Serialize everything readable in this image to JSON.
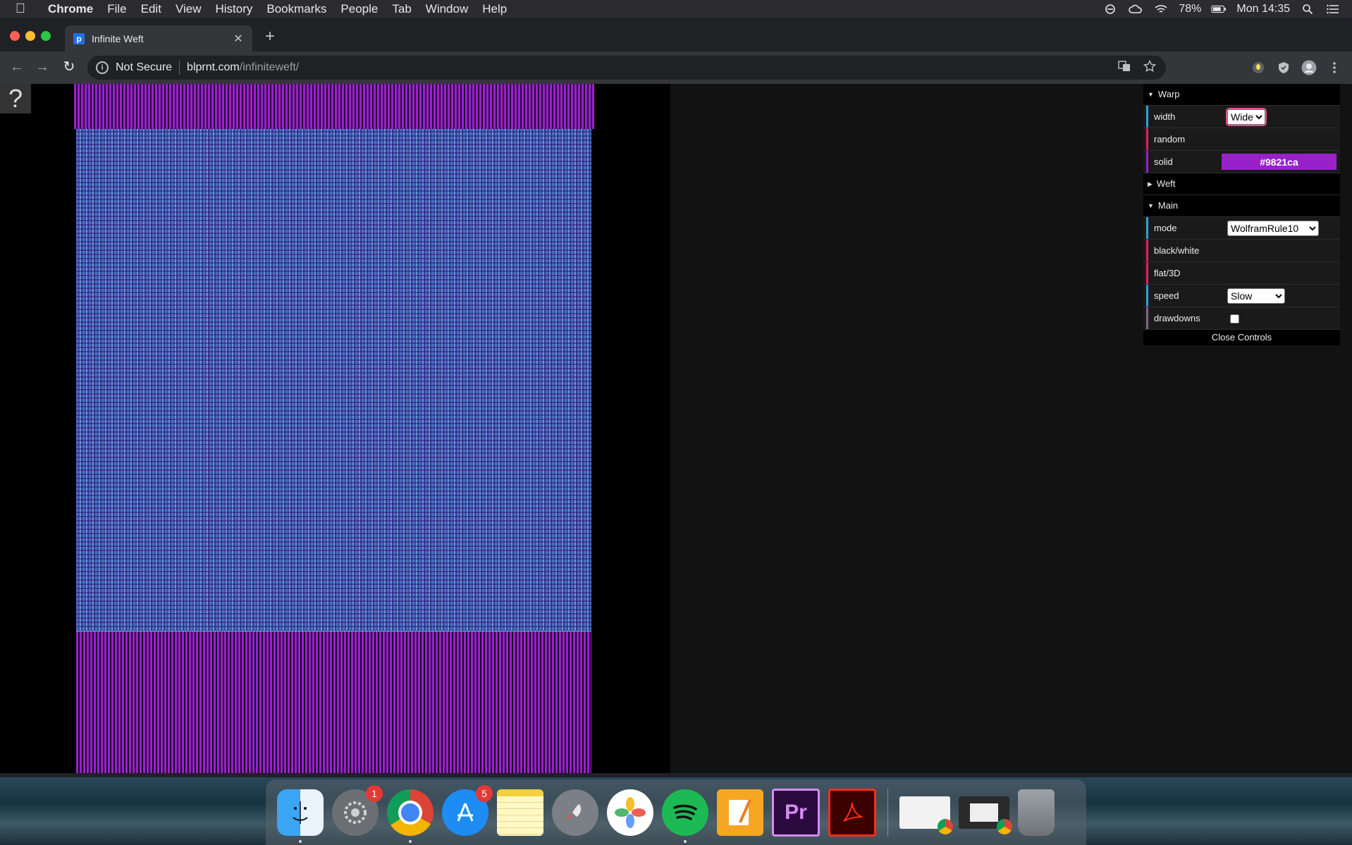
{
  "menubar": {
    "app_name": "Chrome",
    "items": [
      "File",
      "Edit",
      "View",
      "History",
      "Bookmarks",
      "People",
      "Tab",
      "Window",
      "Help"
    ],
    "battery": "78%",
    "clock": "Mon 14:35"
  },
  "browser": {
    "tab_title": "Infinite Weft",
    "tab_favicon": "p",
    "security_label": "Not Secure",
    "url_host": "blprnt.com",
    "url_path": "/infiniteweft/"
  },
  "page": {
    "help_label": "?",
    "weave_color": "#9821ca"
  },
  "gui": {
    "warp": {
      "title": "Warp",
      "width_label": "width",
      "width_value": "Wide",
      "random_label": "random",
      "solid_label": "solid",
      "solid_value": "#9821ca"
    },
    "weft": {
      "title": "Weft"
    },
    "main": {
      "title": "Main",
      "mode_label": "mode",
      "mode_value": "WolframRule10",
      "bw_label": "black/white",
      "flat_label": "flat/3D",
      "speed_label": "speed",
      "speed_value": "Slow",
      "drawdowns_label": "drawdowns"
    },
    "close_label": "Close Controls"
  },
  "dock": {
    "system_prefs_badge": "1",
    "app_store_badge": "5",
    "premiere_label": "Pr"
  }
}
